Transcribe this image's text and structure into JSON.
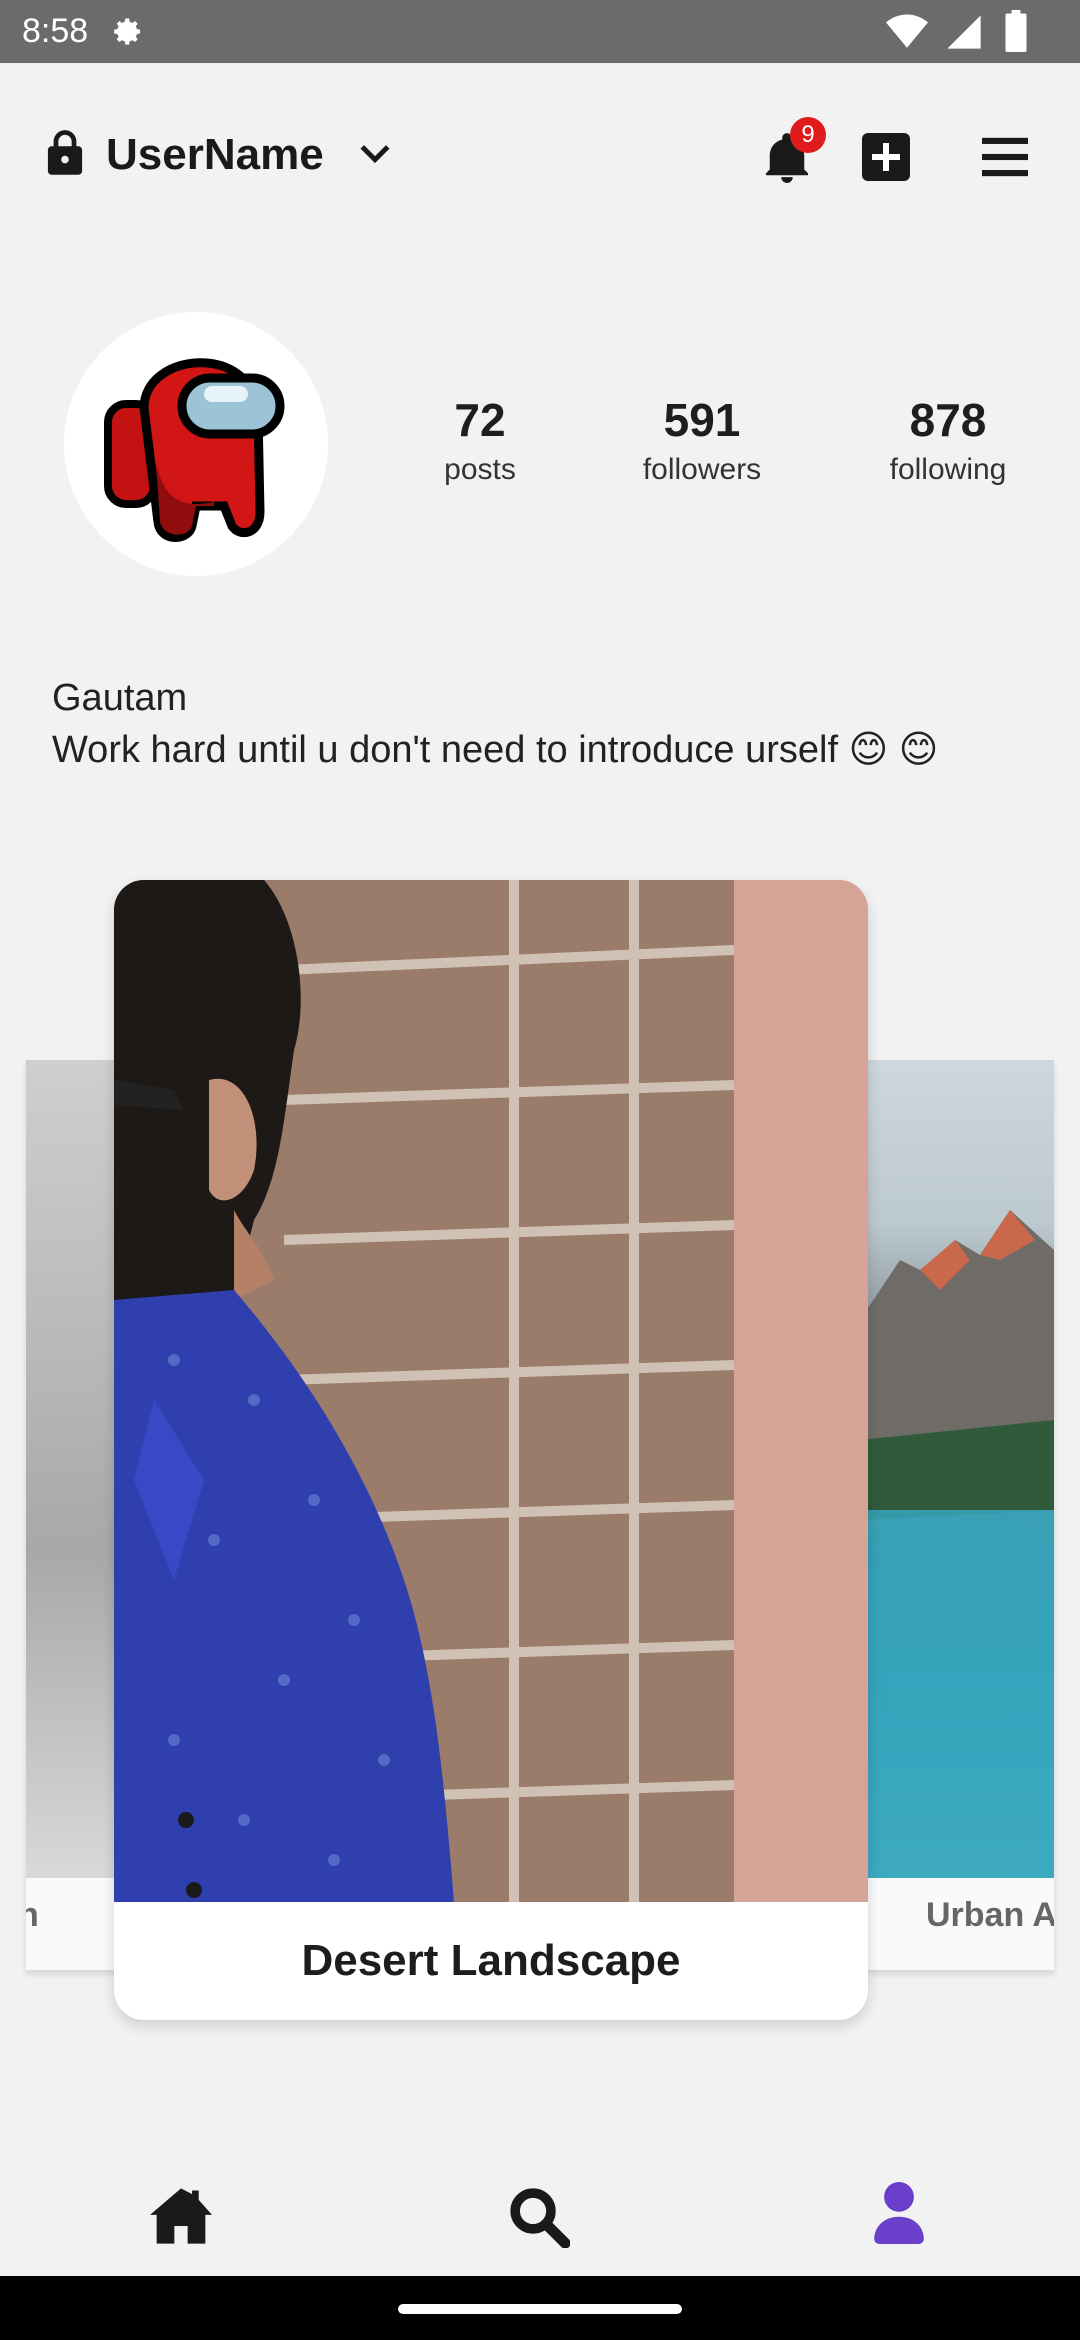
{
  "status_bar": {
    "time": "8:58",
    "icons": [
      "settings-gear-icon",
      "wifi-icon",
      "cell-signal-icon",
      "battery-icon"
    ]
  },
  "header": {
    "username": "UserName",
    "notification_count": "9",
    "icons": [
      "lock-icon",
      "chevron-down-icon",
      "bell-icon",
      "add-post-icon",
      "hamburger-menu-icon"
    ]
  },
  "profile": {
    "stats": {
      "posts": {
        "value": "72",
        "label": "posts"
      },
      "followers": {
        "value": "591",
        "label": "followers"
      },
      "following": {
        "value": "878",
        "label": "following"
      }
    },
    "name": "Gautam",
    "bio": "Work hard until u don't need to introduce urself 😊 😊"
  },
  "carousel": {
    "left_caption": "n",
    "main_caption": "Desert Landscape",
    "right_caption": "Urban A"
  },
  "bottom_nav": {
    "items": [
      "home-icon",
      "search-icon",
      "profile-icon"
    ],
    "active_color": "#6a3fc9"
  },
  "colors": {
    "badge": "#e01b1b",
    "status_bar": "#6b6b6b",
    "background": "#f2f2f2"
  }
}
